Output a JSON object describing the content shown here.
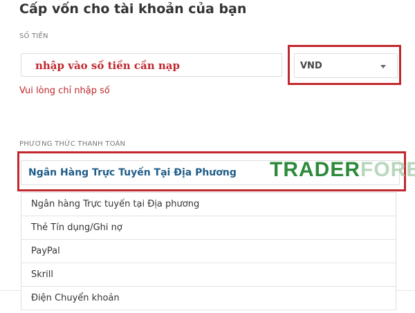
{
  "page": {
    "title": "Cấp vốn cho tài khoản của bạn"
  },
  "amount": {
    "label": "SỐ TIỀN",
    "placeholder": "nhập vào số tiền cần nạp",
    "error": "Vui lòng chỉ nhập số"
  },
  "currency": {
    "selected": "VND"
  },
  "payment": {
    "label": "PHƯƠNG THỨC THANH TOÁN",
    "selected": "Ngân Hàng Trực Tuyến Tại Địa Phương",
    "options": [
      "Ngân hàng Trực tuyến tại Địa phương",
      "Thẻ Tín dụng/Ghi nợ",
      "PayPal",
      "Skrill",
      "Điện Chuyển khoản"
    ]
  },
  "watermark": {
    "part1": "TRADER",
    "part2": "FOREX"
  },
  "colors": {
    "highlight": "#c0272d",
    "selected_text": "#1f5d88",
    "watermark_green": "#2d8a3a"
  }
}
